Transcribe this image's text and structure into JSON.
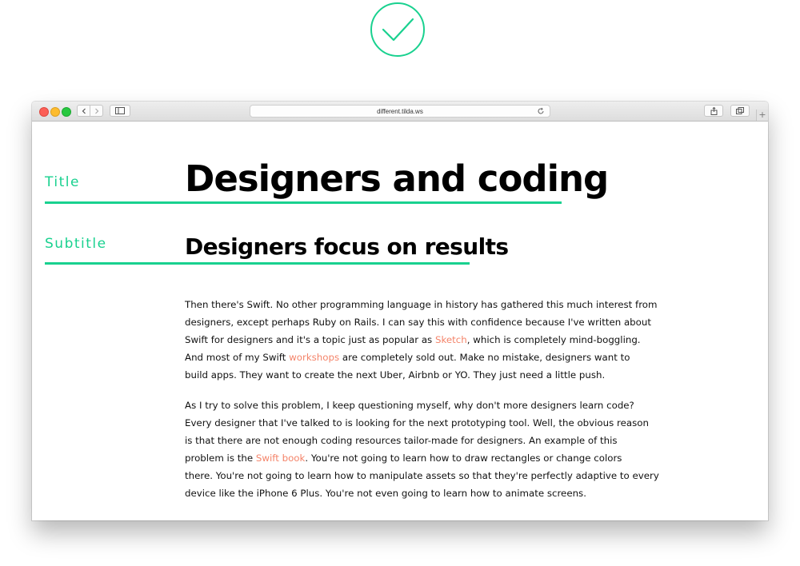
{
  "window": {
    "url": "different.tilda.ws"
  },
  "labels": {
    "title": "Title",
    "subtitle": "Subtitle"
  },
  "article": {
    "title": "Designers and coding",
    "subtitle": "Designers focus on results",
    "paragraph1": [
      [
        "Then there's Swift. No other programming language in history has gathered this much interest from"
      ],
      [
        "designers, except perhaps Ruby on Rails. I can say this with confidence because I've written about"
      ],
      [
        "Swift for designers and it's a topic just as popular as ",
        {
          "link": "Sketch"
        },
        ", which is completely mind-boggling."
      ],
      [
        "And most of my Swift ",
        {
          "link": "workshops"
        },
        " are completely sold out. Make no mistake, designers want to"
      ],
      [
        "build apps. They want to create the next Uber, Airbnb or YO. They just need a little push."
      ]
    ],
    "paragraph2": [
      [
        "As I try to solve this problem, I keep questioning myself, why don't more designers learn code?"
      ],
      [
        "Every designer that I've talked to is looking for the next prototyping tool. Well, the obvious reason"
      ],
      [
        "is that there are not enough coding resources tailor-made for designers. An example of this"
      ],
      [
        "problem is the ",
        {
          "link": "Swift book"
        },
        ". You're not going to learn how to draw rectangles or change colors"
      ],
      [
        "there. You're not going to learn how to manipulate assets so that they're perfectly adaptive to every"
      ],
      [
        "device like the iPhone 6 Plus. You're not even going to learn how to animate screens."
      ]
    ]
  },
  "colors": {
    "accent": "#19d18f",
    "link": "#f4846a"
  },
  "icons": {
    "badge": "checkmark-circle-icon"
  }
}
